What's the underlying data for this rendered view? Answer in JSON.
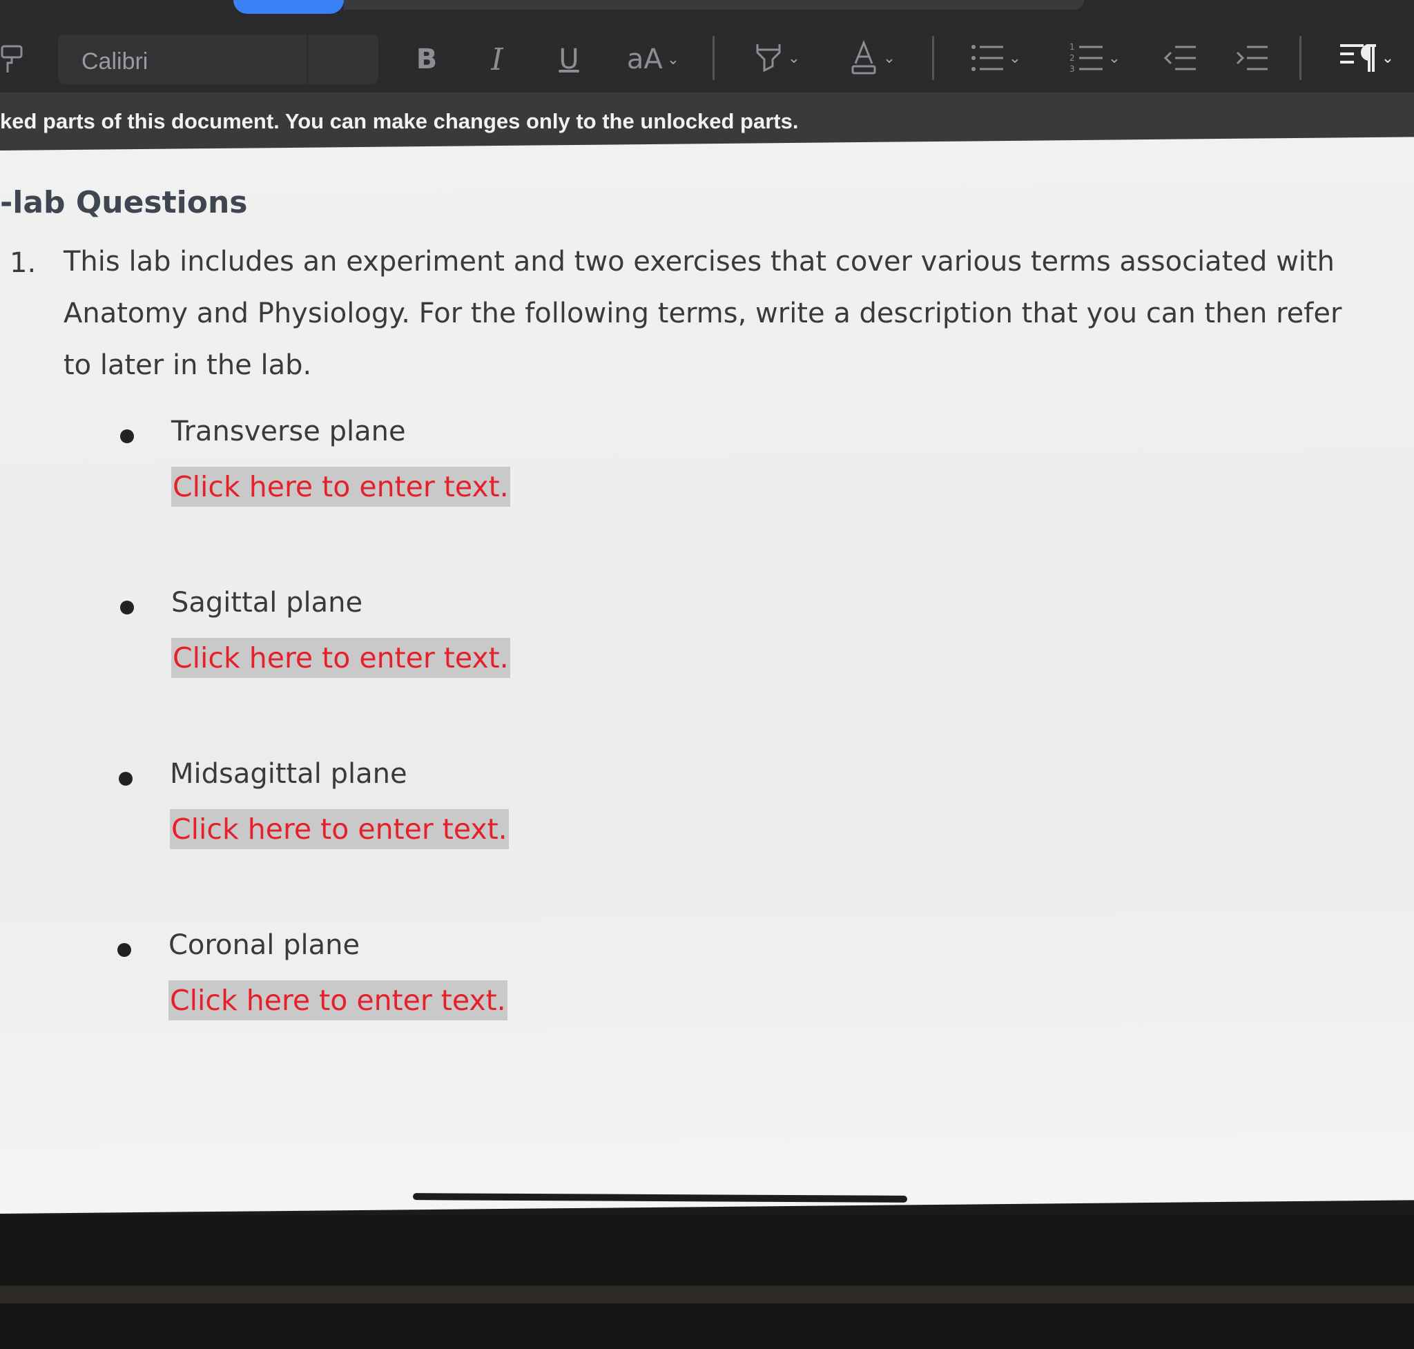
{
  "toolbar": {
    "font_name": "Calibri",
    "bold_label": "B",
    "italic_label": "I",
    "underline_label": "U",
    "font_size_label": "aA",
    "icons": [
      "format-painter-icon",
      "bold-icon",
      "italic-icon",
      "underline-icon",
      "font-size-icon",
      "highlight-icon",
      "font-color-icon",
      "bullet-list-icon",
      "numbered-list-icon",
      "decrease-indent-icon",
      "increase-indent-icon",
      "paragraph-mark-icon"
    ]
  },
  "notice": {
    "text": "ked parts of this document. You can make changes only to the unlocked parts."
  },
  "document": {
    "heading": "-lab Questions",
    "question": {
      "number": "1.",
      "text": "This lab includes an experiment and two exercises that cover various terms associated with Anatomy and Physiology. For the following terms, write a description that you can then refer to later in the lab."
    },
    "terms": [
      {
        "label": "Transverse plane",
        "placeholder": "Click here to enter text."
      },
      {
        "label": "Sagittal plane",
        "placeholder": "Click here to enter text."
      },
      {
        "label": "Midsagittal plane",
        "placeholder": "Click here to enter text."
      },
      {
        "label": "Coronal plane",
        "placeholder": "Click here to enter text."
      }
    ]
  },
  "colors": {
    "placeholder_text": "#e5202a",
    "placeholder_bg": "#c9c9c9",
    "heading": "#3f4652",
    "toolbar_bg": "#2b2b2e"
  }
}
